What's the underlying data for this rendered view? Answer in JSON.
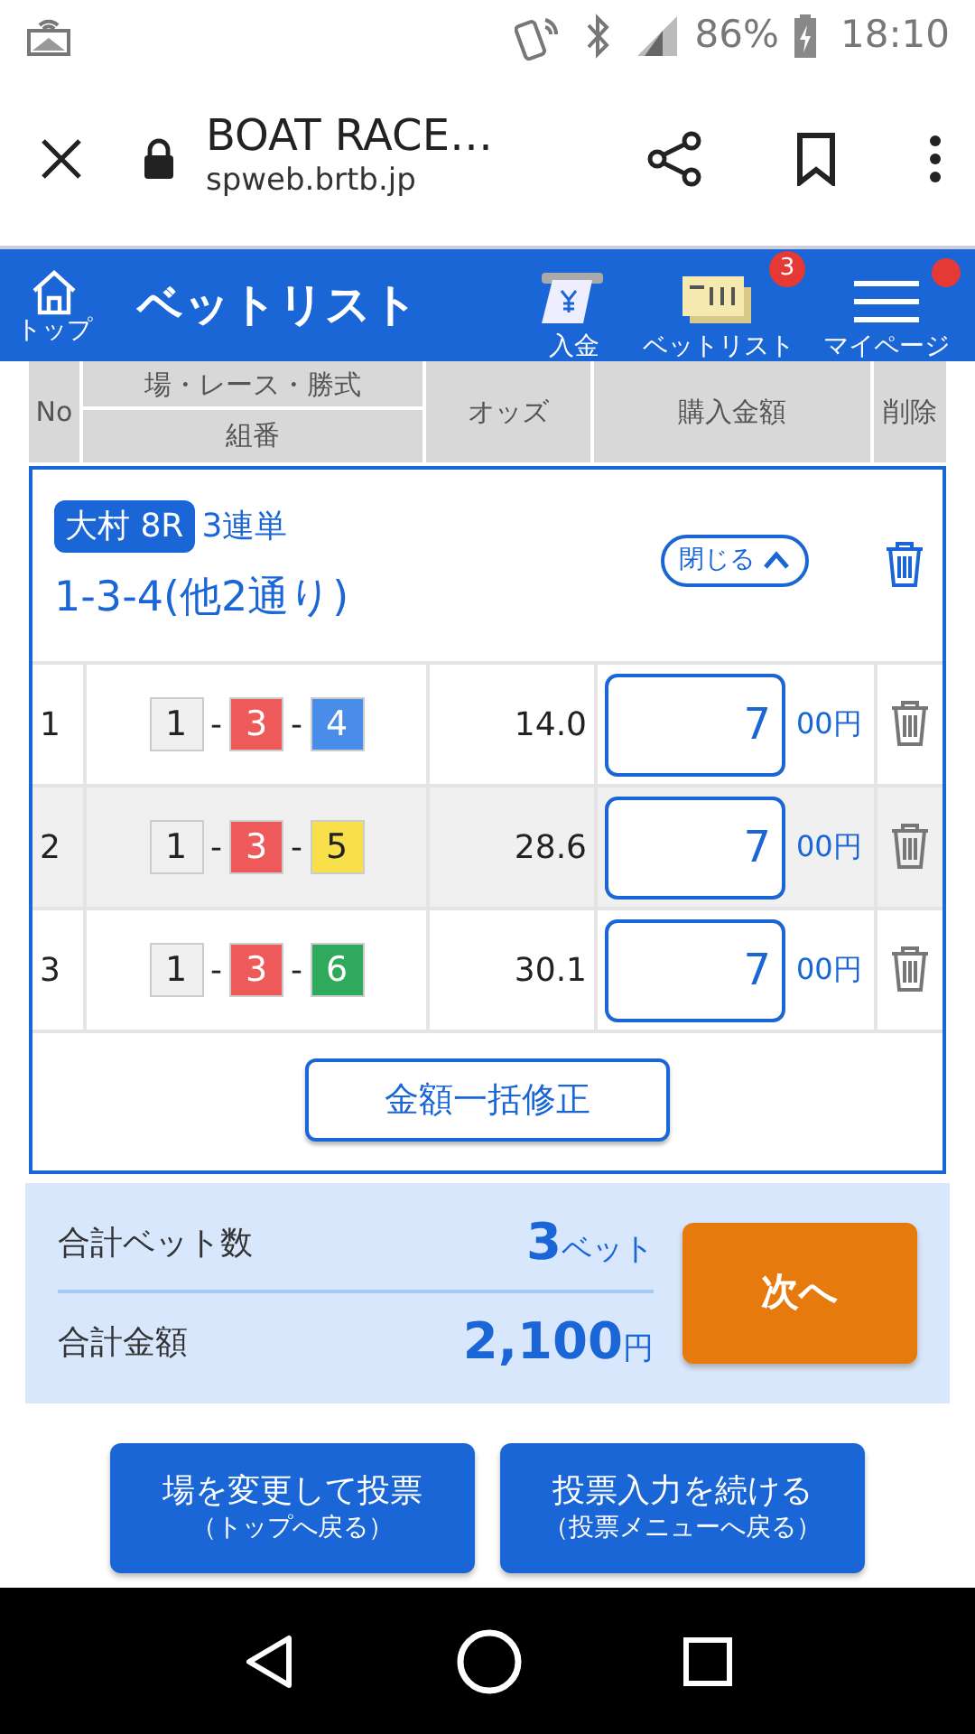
{
  "status_bar": {
    "battery": "86%",
    "time": "18:10"
  },
  "browser": {
    "title": "BOAT RACE…",
    "url": "spweb.brtb.jp"
  },
  "header": {
    "home_label": "トップ",
    "title": "ベットリスト",
    "actions": [
      {
        "kind": "deposit",
        "label": "入金"
      },
      {
        "kind": "betlist",
        "label": "ベットリスト",
        "badge": "3"
      },
      {
        "kind": "mypage",
        "label": "マイページ",
        "notification": true
      }
    ]
  },
  "table_header": {
    "no": "No",
    "race_line": "場・レース・勝式",
    "combo": "組番",
    "odds": "オッズ",
    "amount": "購入金額",
    "delete": "削除"
  },
  "bet_group": {
    "venue": "大村 8R",
    "type": "3連単",
    "summary": "1-3-4(他2通り)",
    "toggle": "閉じる",
    "expanded": true,
    "rows": [
      {
        "no": "1",
        "separators": [
          "-",
          "-"
        ],
        "boats": [
          {
            "number": "1",
            "color": "#f0f0f0"
          },
          {
            "number": "3",
            "color": "#ee5a5a"
          },
          {
            "number": "4",
            "color": "#4a8de8"
          }
        ],
        "odds": "14.0",
        "amount": "7",
        "unit": "00円"
      },
      {
        "no": "2",
        "separators": [
          "-",
          "-"
        ],
        "boats": [
          {
            "number": "1",
            "color": "#f0f0f0"
          },
          {
            "number": "3",
            "color": "#ee5a5a"
          },
          {
            "number": "5",
            "color": "#f7e04a"
          }
        ],
        "odds": "28.6",
        "amount": "7",
        "unit": "00円"
      },
      {
        "no": "3",
        "separators": [
          "-",
          "-"
        ],
        "boats": [
          {
            "number": "1",
            "color": "#f0f0f0"
          },
          {
            "number": "3",
            "color": "#ee5a5a"
          },
          {
            "number": "6",
            "color": "#2fa95c"
          }
        ],
        "odds": "30.1",
        "amount": "7",
        "unit": "00円"
      }
    ],
    "bulk_edit": "金額一括修正"
  },
  "summary": {
    "bet_count_label": "合計ベット数",
    "bet_count": "3",
    "bet_unit": "ベット",
    "total_label": "合計金額",
    "total": "2,100",
    "total_unit": "円",
    "next": "次へ"
  },
  "footer_buttons": [
    {
      "title": "場を変更して投票",
      "sub": "（トップへ戻る）"
    },
    {
      "title": "投票入力を続ける",
      "sub": "（投票メニューへ戻る）"
    }
  ]
}
